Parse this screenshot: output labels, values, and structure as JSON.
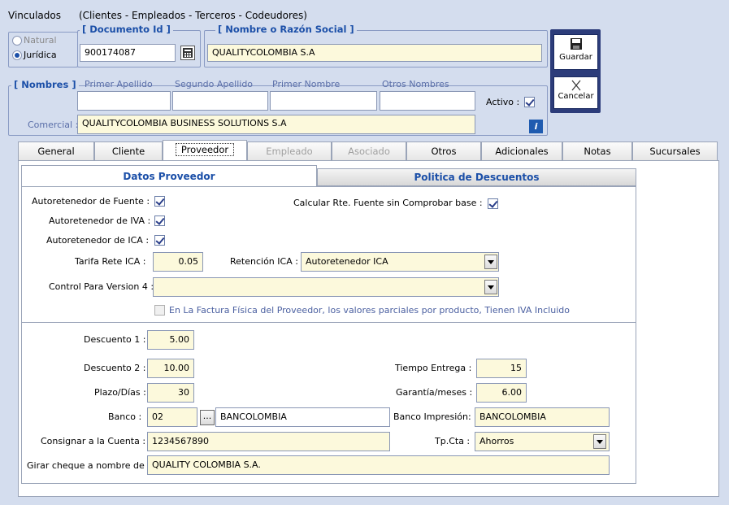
{
  "window_title": "Vinculados",
  "window_subtitle": "(Clientes - Empleados - Terceros - Codeudores)",
  "persona": {
    "natural_label": "Natural",
    "juridica_label": "Jurídica",
    "selected": "Jurídica"
  },
  "documento": {
    "group_title": "[ Documento Id ]",
    "value": "900174087"
  },
  "razon_social": {
    "group_title": "[ Nombre o Razón Social ]",
    "value": "QUALITYCOLOMBIA S.A"
  },
  "nombres": {
    "group_title": "[ Nombres ]",
    "primer_apellido_label": "Primer Apellido",
    "segundo_apellido_label": "Segundo Apellido",
    "primer_nombre_label": "Primer Nombre",
    "otros_nombres_label": "Otros Nombres",
    "primer_apellido": "",
    "segundo_apellido": "",
    "primer_nombre": "",
    "otros_nombres": "",
    "activo_label": "Activo :",
    "activo_checked": true,
    "comercial_label": "Comercial :",
    "comercial_value": "QUALITYCOLOMBIA BUSINESS SOLUTIONS S.A",
    "info_glyph": "i"
  },
  "buttons": {
    "guardar": "Guardar",
    "cancelar": "Cancelar"
  },
  "tabs": [
    {
      "label": "General",
      "state": "normal"
    },
    {
      "label": "Cliente",
      "state": "normal"
    },
    {
      "label": "Proveedor",
      "state": "active"
    },
    {
      "label": "Empleado",
      "state": "disabled"
    },
    {
      "label": "Asociado",
      "state": "disabled"
    },
    {
      "label": "Otros",
      "state": "normal"
    },
    {
      "label": "Adicionales",
      "state": "normal"
    },
    {
      "label": "Notas",
      "state": "normal"
    },
    {
      "label": "Sucursales",
      "state": "normal"
    }
  ],
  "subtabs": {
    "datos": "Datos Proveedor",
    "politica": "Politica de Descuentos"
  },
  "proveedor": {
    "autoret_fuente_label": "Autoretenedor de Fuente :",
    "autoret_iva_label": "Autoretenedor de IVA :",
    "autoret_ica_label": "Autoretenedor de ICA :",
    "calcular_label": "Calcular Rte. Fuente sin Comprobar base :",
    "tarifa_label": "Tarifa Rete ICA :",
    "tarifa_value": "0.05",
    "retencion_label": "Retención ICA :",
    "retencion_value": "Autoretenedor ICA",
    "control_label": "Control Para Version 4 :",
    "control_value": "",
    "factura_label": "En La Factura Física del Proveedor, los valores parciales  por producto, Tienen IVA Incluido",
    "descuento1_label": "Descuento 1 :",
    "descuento1_value": "5.00",
    "descuento2_label": "Descuento 2 :",
    "descuento2_value": "10.00",
    "plazo_label": "Plazo/Días :",
    "plazo_value": "30",
    "tiempo_label": "Tiempo Entrega :",
    "tiempo_value": "15",
    "garantia_label": "Garantía/meses :",
    "garantia_value": "6.00",
    "banco_label": "Banco :",
    "banco_code": "02",
    "banco_btn": "...",
    "banco_name": "BANCOLOMBIA",
    "banco_imp_label": "Banco Impresión:",
    "banco_imp_value": "BANCOLOMBIA",
    "cuenta_label": "Consignar a la Cuenta :",
    "cuenta_value": "1234567890",
    "tpcta_label": "Tp.Cta :",
    "tpcta_value": "Ahorros",
    "cheque_label": "Girar cheque a nombre de :",
    "cheque_value": "QUALITY COLOMBIA S.A."
  }
}
